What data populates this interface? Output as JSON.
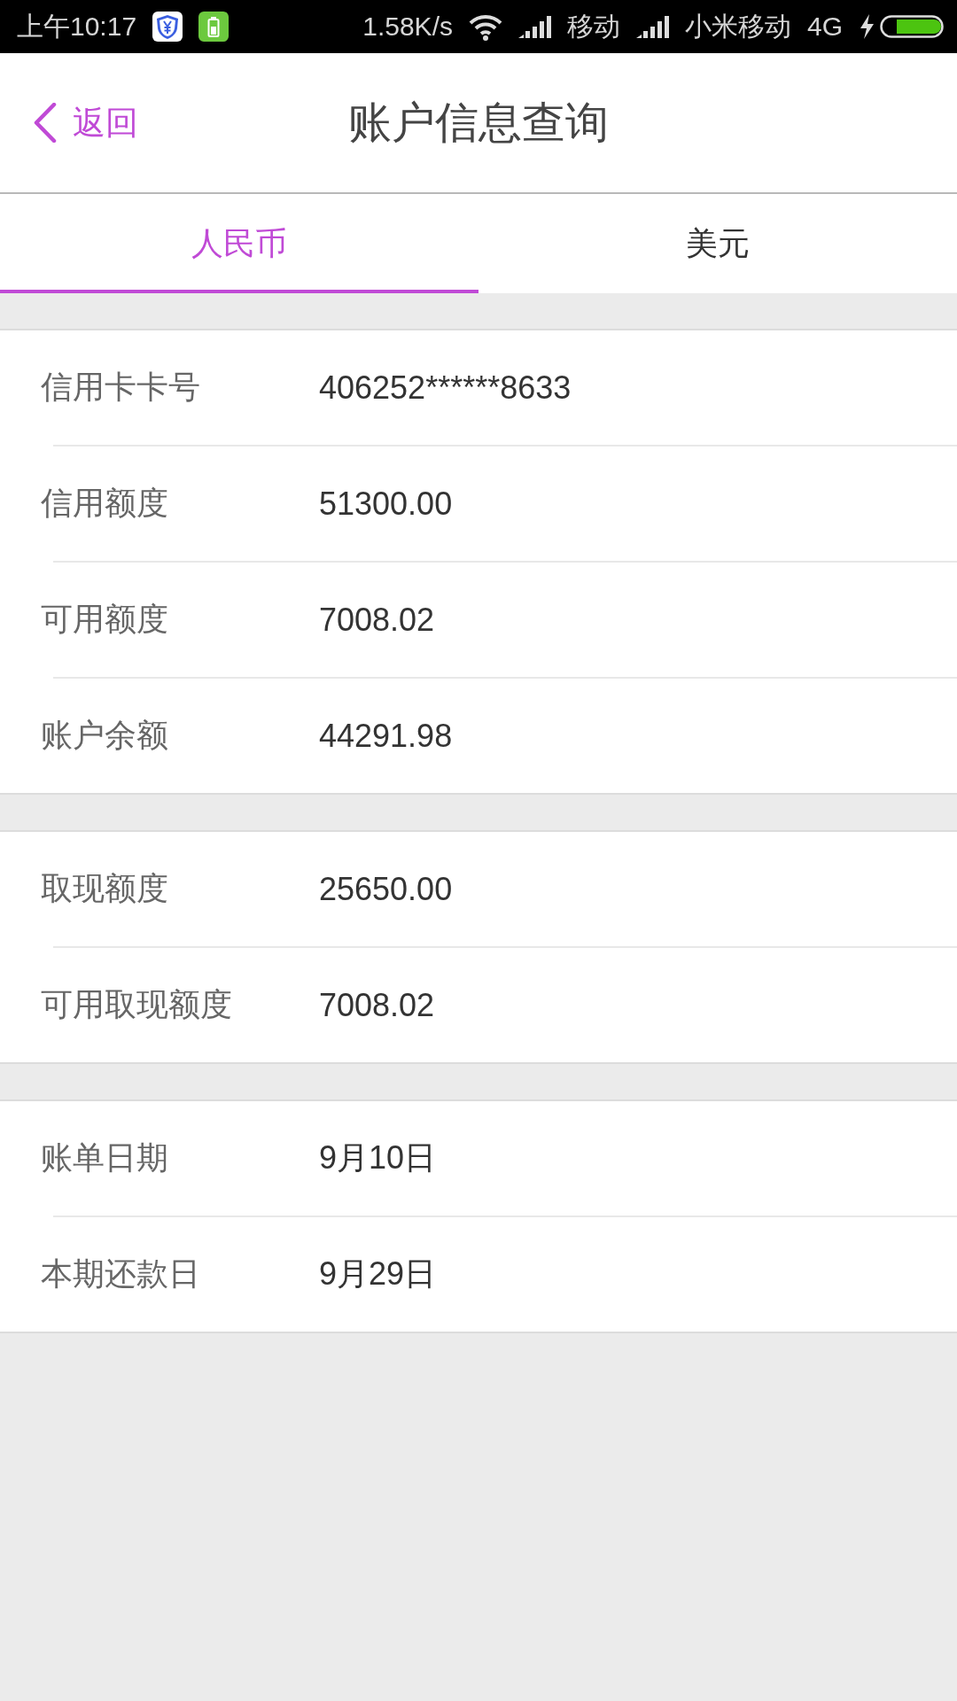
{
  "status_bar": {
    "time": "上午10:17",
    "speed": "1.58K/s",
    "carriers": [
      {
        "name": "移动"
      },
      {
        "name": "小米移动"
      }
    ],
    "network": "4G",
    "charging": true
  },
  "header": {
    "back": "返回",
    "title": "账户信息查询"
  },
  "tabs": [
    {
      "label": "人民币",
      "selected": true
    },
    {
      "label": "美元",
      "selected": false
    }
  ],
  "groups": [
    {
      "rows": [
        {
          "label": "信用卡卡号",
          "value": "406252******8633"
        },
        {
          "label": "信用额度",
          "value": "51300.00"
        },
        {
          "label": "可用额度",
          "value": "7008.02"
        },
        {
          "label": "账户余额",
          "value": "44291.98"
        }
      ]
    },
    {
      "rows": [
        {
          "label": "取现额度",
          "value": "25650.00"
        },
        {
          "label": "可用取现额度",
          "value": "7008.02"
        }
      ]
    },
    {
      "rows": [
        {
          "label": "账单日期",
          "value": "9月10日"
        },
        {
          "label": "本期还款日",
          "value": "9月29日"
        }
      ]
    }
  ]
}
